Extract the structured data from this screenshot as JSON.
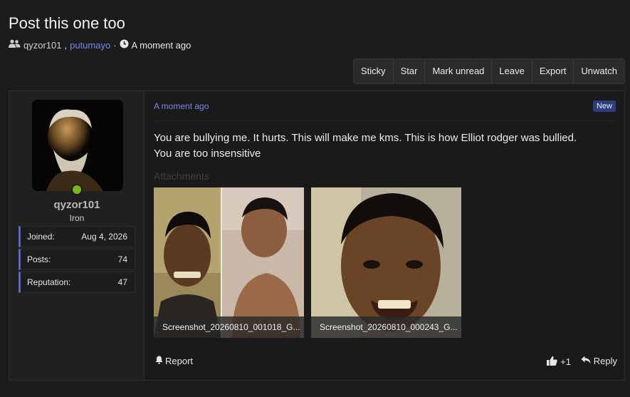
{
  "thread": {
    "title": "Post this one too",
    "participants": [
      "qyzor101",
      "putumayo"
    ],
    "separator": "·",
    "time": "A moment ago"
  },
  "actions": [
    "Sticky",
    "Star",
    "Mark unread",
    "Leave",
    "Export",
    "Unwatch"
  ],
  "author": {
    "username": "qyzor101",
    "rank": "Iron",
    "online": true,
    "stats": [
      {
        "label": "Joined:",
        "value": "Aug 4, 2026"
      },
      {
        "label": "Posts:",
        "value": "74"
      },
      {
        "label": "Reputation:",
        "value": "47"
      }
    ]
  },
  "post": {
    "time": "A moment ago",
    "badge": "New",
    "message_line1": "You are bullying me. It hurts. This will make me kms. This is how Elliot rodger was bullied.",
    "message_line2": "You are too insensitive",
    "attachments_label": "Attachments",
    "attachments": [
      {
        "filename": "Screenshot_20260810_001018_G..."
      },
      {
        "filename": "Screenshot_20260810_000243_G..."
      }
    ],
    "report_label": "Report",
    "reaction_count": "+1",
    "reply_label": "Reply"
  }
}
